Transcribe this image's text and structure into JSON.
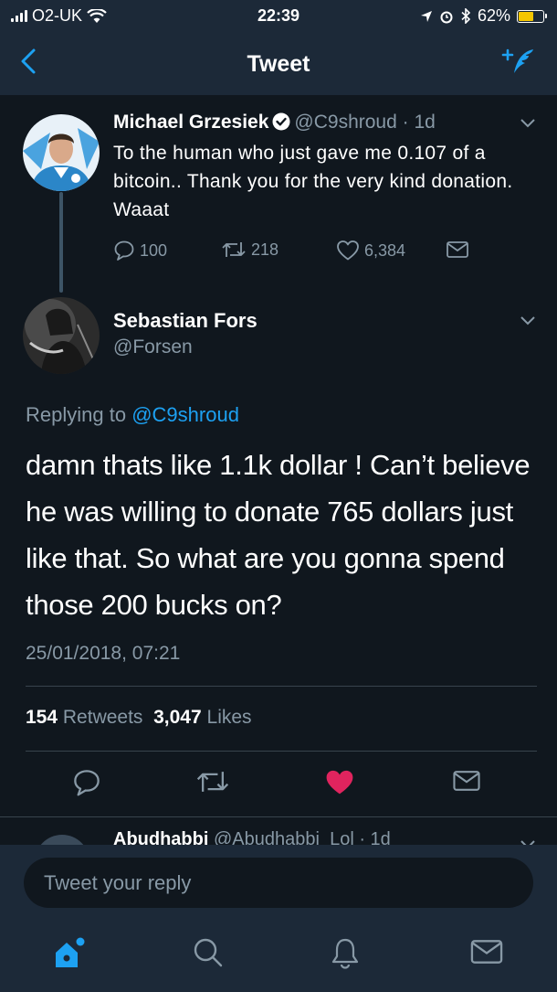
{
  "status_bar": {
    "carrier": "O2-UK",
    "time": "22:39",
    "battery": "62%",
    "battery_level": 0.62,
    "battery_color": "#f5c600"
  },
  "nav": {
    "title": "Tweet",
    "back_icon": "chevron-left-icon",
    "compose_icon": "compose-tweet-icon"
  },
  "parent_tweet": {
    "name": "Michael Grzesiek",
    "verified": true,
    "handle": "@C9shroud",
    "separator": "·",
    "age": "1d",
    "text": "To the human who just gave me 0.107 of a bitcoin.. Thank you for the very kind donation. Waaat",
    "replies": "100",
    "retweets": "218",
    "likes": "6,384"
  },
  "main_tweet": {
    "name": "Sebastian Fors",
    "handle": "@Forsen",
    "replying_prefix": "Replying to",
    "replying_to": "@C9shroud",
    "text": "damn thats like 1.1k dollar ! Can’t believe he was willing to donate 765 dollars just like that. So what are you gonna spend those 200 bucks on?",
    "timestamp": "25/01/2018, 07:21",
    "retweet_count": "154",
    "retweet_label": "Retweets",
    "like_count": "3,047",
    "like_label": "Likes",
    "liked": true
  },
  "next_reply": {
    "name": "Abudhabbi",
    "handle": "@Abudhabbi_Lol",
    "age": "1d"
  },
  "reply_box": {
    "placeholder": "Tweet your reply"
  },
  "tab_bar": [
    "home-icon",
    "search-icon",
    "notifications-icon",
    "messages-icon"
  ],
  "colors": {
    "accent": "#1da1f2",
    "like": "#e0245e",
    "background": "#10171e",
    "bar": "#1c2938",
    "secondary_text": "#8899a6"
  }
}
